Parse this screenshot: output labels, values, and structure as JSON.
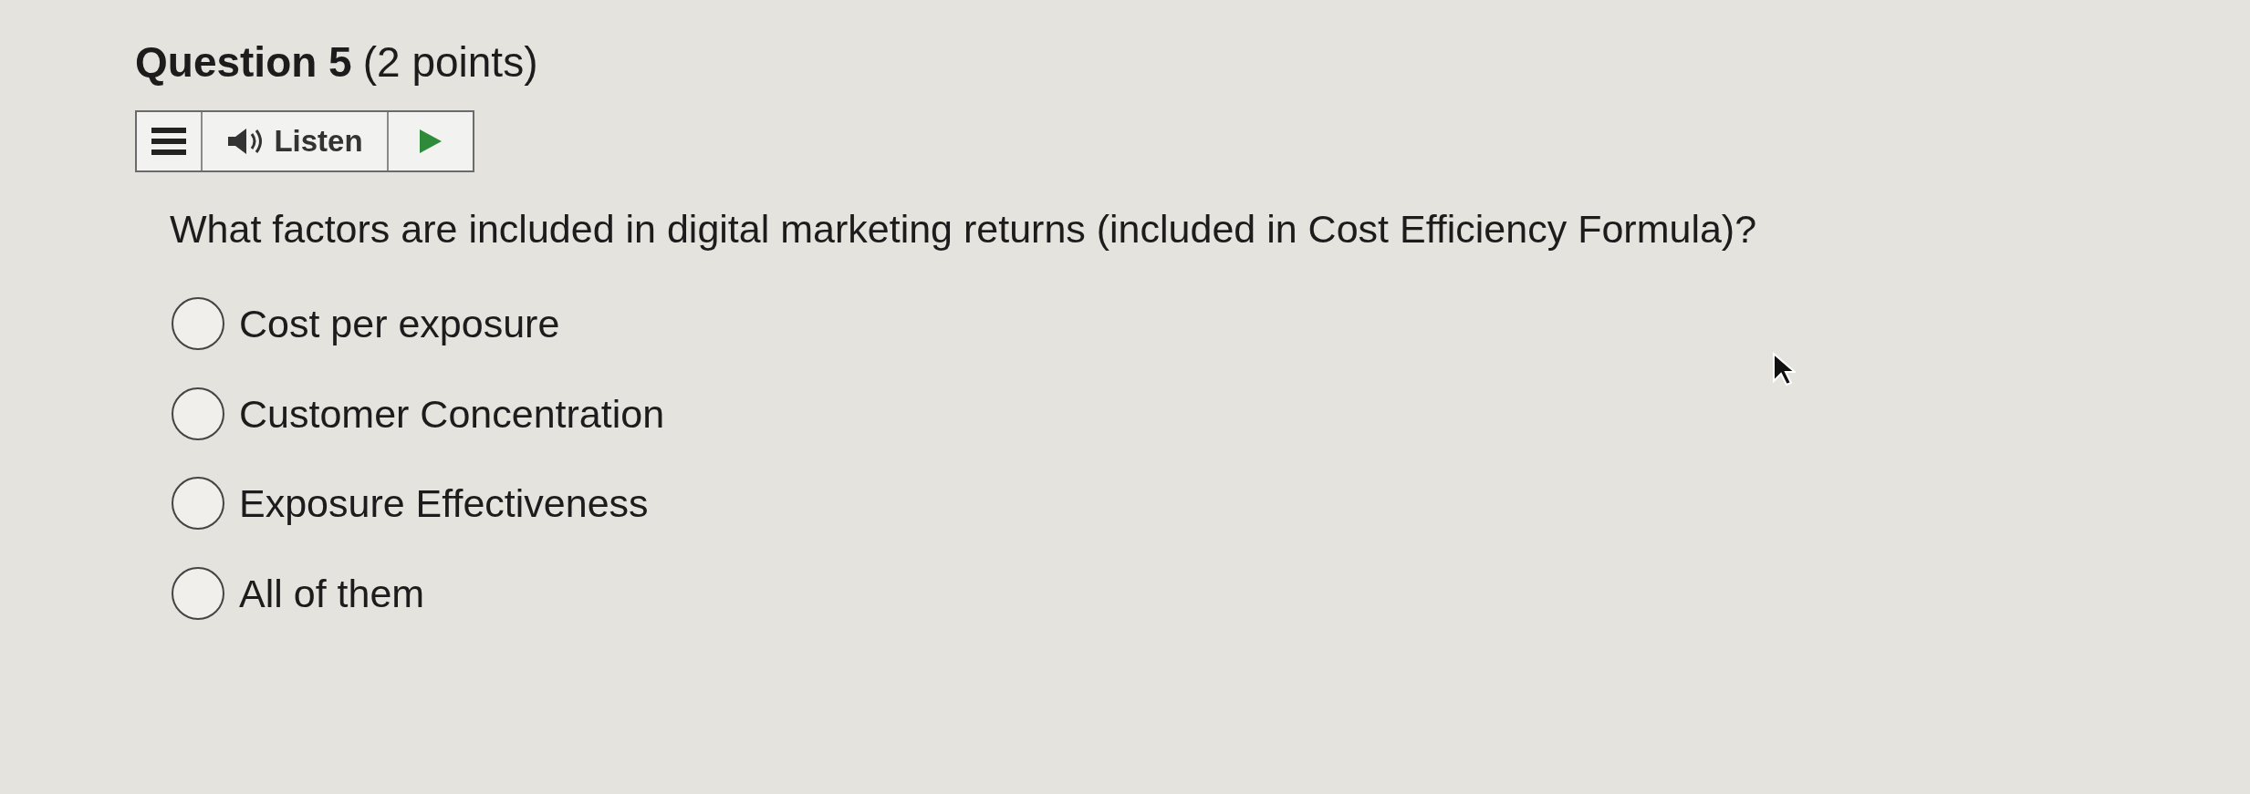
{
  "question": {
    "title": "Question 5",
    "points": "(2 points)"
  },
  "toolbar": {
    "listen_label": "Listen"
  },
  "prompt": "What factors are included in digital marketing returns (included in Cost Efficiency Formula)?",
  "options": [
    {
      "label": "Cost per exposure",
      "selected": false
    },
    {
      "label": "Customer Concentration",
      "selected": false
    },
    {
      "label": "Exposure Effectiveness",
      "selected": false
    },
    {
      "label": "All of them",
      "selected": false
    }
  ]
}
